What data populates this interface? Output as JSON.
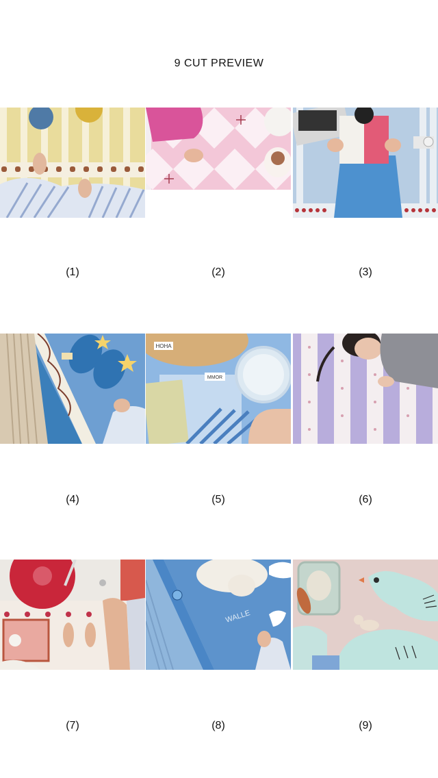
{
  "page": {
    "title": "9 CUT PREVIEW"
  },
  "cuts": [
    {
      "label": "(1)",
      "subject": "feet-on-yellow-striped-mat"
    },
    {
      "label": "(2)",
      "subject": "feet-on-pink-diamond-mat"
    },
    {
      "label": "(3)",
      "subject": "child-reading-on-blue-striped-mat"
    },
    {
      "label": "(4)",
      "subject": "slippers-on-blue-rug"
    },
    {
      "label": "(5)",
      "subject": "glass-and-cutting-board-on-blue"
    },
    {
      "label": "(6)",
      "subject": "child-lying-on-lavender-striped-mat"
    },
    {
      "label": "(7)",
      "subject": "record-player-and-tray"
    },
    {
      "label": "(8)",
      "subject": "plush-toy-on-blue-bird-mat",
      "mat_text": "WALLE"
    },
    {
      "label": "(9)",
      "subject": "toys-on-mint-bird-mat"
    }
  ],
  "badges": {
    "hoha": "HOHA",
    "mmor": "MMOR"
  }
}
